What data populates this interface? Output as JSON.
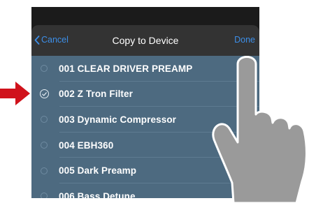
{
  "navbar": {
    "cancel_label": "Cancel",
    "title": "Copy to Device",
    "done_label": "Done"
  },
  "list": {
    "items": [
      {
        "label": "001 CLEAR DRIVER PREAMP",
        "selected": false
      },
      {
        "label": "002 Z Tron Filter",
        "selected": true
      },
      {
        "label": "003 Dynamic Compressor",
        "selected": false
      },
      {
        "label": "004 EBH360",
        "selected": false
      },
      {
        "label": "005 Dark Preamp",
        "selected": false
      },
      {
        "label": "006 Bass Detune",
        "selected": false
      }
    ]
  },
  "colors": {
    "accent": "#3d8fe8",
    "list_background": "#4d6a80",
    "pointer_arrow": "#d0121b",
    "hand_fill": "#9a9a9a"
  },
  "icons": {
    "back": "chevron-left-icon",
    "check": "checkmark-circle-icon",
    "pointer": "red-arrow-icon",
    "hand": "pointing-hand-icon"
  }
}
